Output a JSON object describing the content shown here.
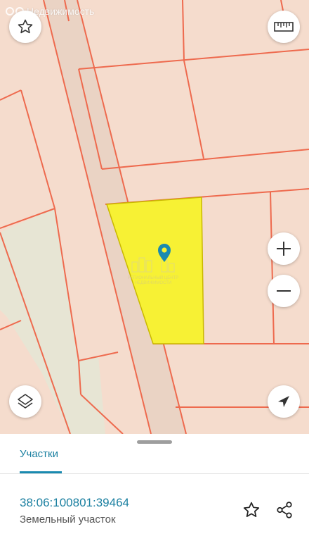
{
  "map": {
    "watermark": "Недвижимость",
    "parcel_watermark": [
      "РЕГИОНАЛЬНЫЙ ЦЕНТР",
      "НЕДВИЖИМОСТИ"
    ],
    "colors": {
      "background": "#f5dccd",
      "boundary": "#ee6a4e",
      "road": "#ead3c4",
      "green_area": "#e6e6d6",
      "selected_parcel": "#f7f134",
      "pin": "#1a8ab0"
    },
    "controls": {
      "favorite_icon": "star-outline-icon",
      "ruler_icon": "ruler-icon",
      "zoom_in_icon": "plus-icon",
      "zoom_out_icon": "minus-icon",
      "layers_icon": "layers-icon",
      "location_icon": "navigation-arrow-icon"
    }
  },
  "sheet": {
    "tab_label": "Участки",
    "parcel": {
      "cadastral_number": "38:06:100801:39464",
      "type": "Земельный участок"
    },
    "actions": {
      "favorite_icon": "star-outline-icon",
      "share_icon": "share-icon"
    }
  }
}
